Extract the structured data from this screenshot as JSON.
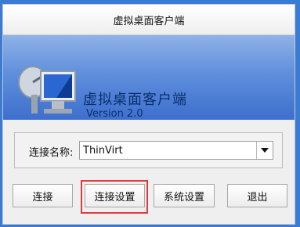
{
  "window": {
    "title": "虚拟桌面客户端"
  },
  "brand": {
    "title": "虚拟桌面客户端",
    "version": "Version 2.0"
  },
  "connection": {
    "label": "连接名称:",
    "selected": "ThinVirt"
  },
  "buttons": {
    "connect": "连接",
    "connection_settings": "连接设置",
    "system_settings": "系统设置",
    "exit": "退出"
  },
  "colors": {
    "accent": "#3d6fcd",
    "highlight": "#e03b3b"
  },
  "icons": {
    "hero": "satellite-monitor-icon",
    "dropdown": "chevron-down-icon"
  }
}
